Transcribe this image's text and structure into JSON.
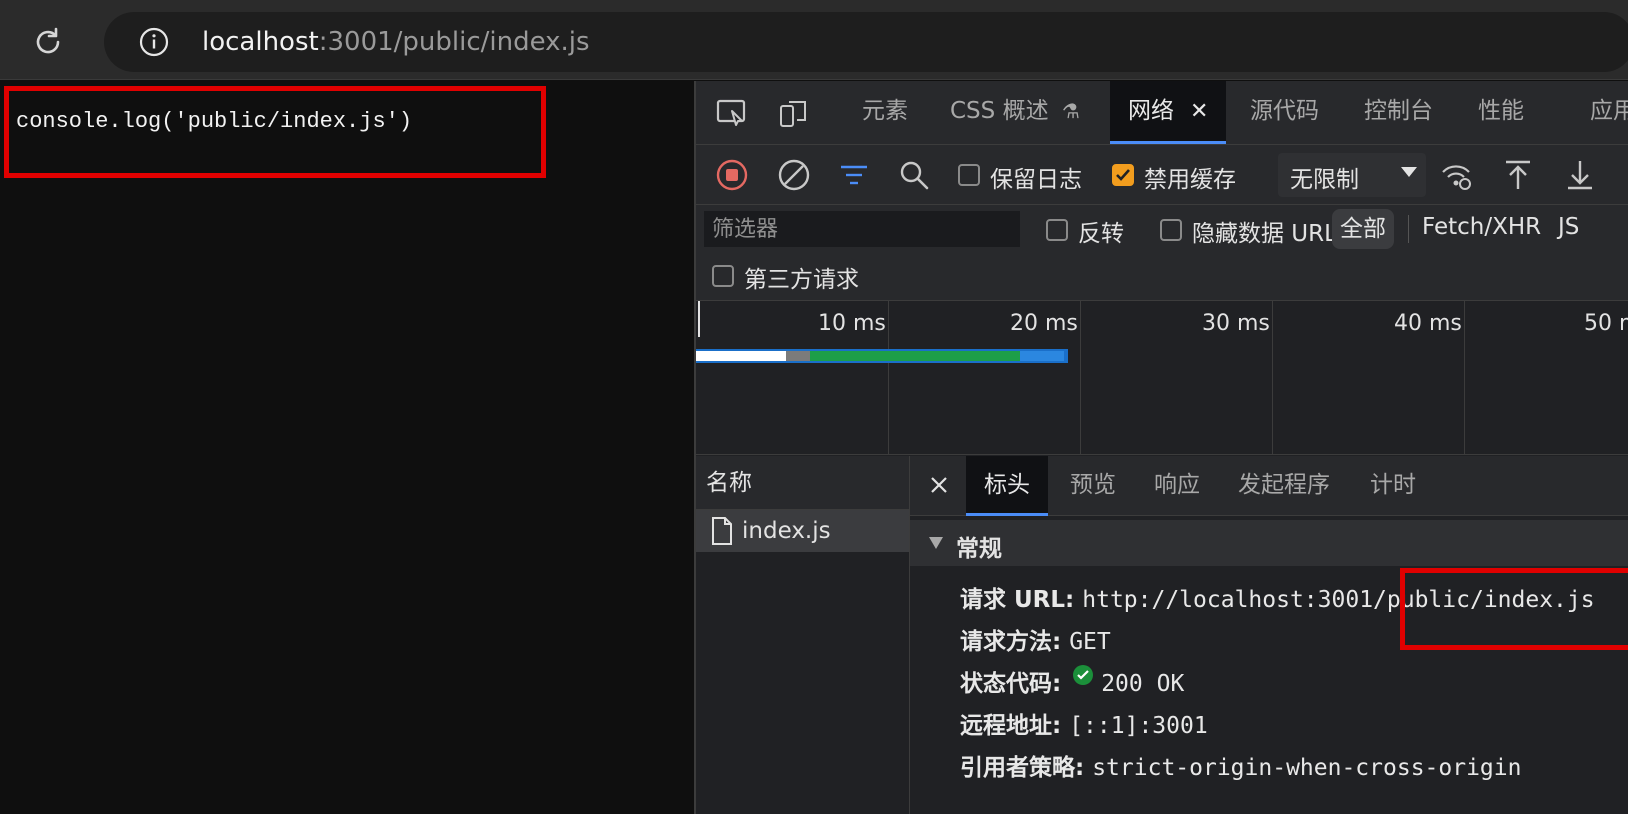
{
  "browser": {
    "url_host": "localhost",
    "url_rest": ":3001/public/index.js"
  },
  "page": {
    "code_text": "console.log('public/index.js')"
  },
  "devtools": {
    "tabs": [
      {
        "label": "元素"
      },
      {
        "label": "CSS 概述"
      },
      {
        "label": "网络"
      },
      {
        "label": "源代码"
      },
      {
        "label": "控制台"
      },
      {
        "label": "性能"
      },
      {
        "label": "应用"
      }
    ],
    "toolbar": {
      "preserve_log_label": "保留日志",
      "preserve_log_checked": false,
      "disable_cache_label": "禁用缓存",
      "disable_cache_checked": true,
      "throttling_value": "无限制"
    },
    "filter": {
      "placeholder": "筛选器",
      "invert_label": "反转",
      "hide_data_url_label": "隐藏数据 URL",
      "type_all": "全部",
      "type_fetch": "Fetch/XHR",
      "type_js": "JS",
      "third_party_label": "第三方请求"
    },
    "waterfall": {
      "ticks": [
        "10 ms",
        "20 ms",
        "30 ms",
        "40 ms",
        "50 ms"
      ]
    },
    "requests": {
      "header": "名称",
      "items": [
        {
          "name": "index.js"
        }
      ]
    },
    "detail": {
      "tabs": [
        "标头",
        "预览",
        "响应",
        "发起程序",
        "计时"
      ],
      "section_title": "常规",
      "fields": {
        "request_url_key": "请求 URL:",
        "request_url_value": "http://localhost:3001/public/index.js",
        "method_key": "请求方法:",
        "method_value": "GET",
        "status_key": "状态代码:",
        "status_value": "200 OK",
        "remote_key": "远程地址:",
        "remote_value": "[::1]:3001",
        "referrer_key": "引用者策略:",
        "referrer_value": "strict-origin-when-cross-origin"
      }
    }
  },
  "colors": {
    "annotation_red": "#e00000",
    "accent_blue": "#4b8df8",
    "checkbox_orange": "#f29d1e",
    "status_green": "#1b8f3a"
  }
}
